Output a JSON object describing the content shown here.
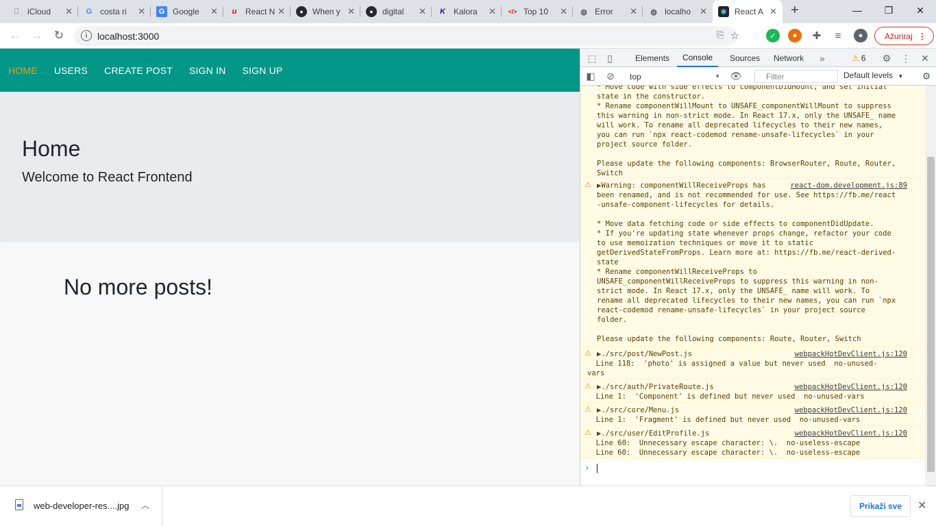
{
  "tabs": [
    {
      "title": "iCloud",
      "icon": "apple-icon"
    },
    {
      "title": "costa ri",
      "icon": "google-icon"
    },
    {
      "title": "Google",
      "icon": "google-translate-icon"
    },
    {
      "title": "React N",
      "icon": "react-native-icon"
    },
    {
      "title": "When y",
      "icon": "github-icon"
    },
    {
      "title": "digital",
      "icon": "github-icon"
    },
    {
      "title": "Kalora",
      "icon": "kaloraat-icon"
    },
    {
      "title": "Top 10",
      "icon": "code-icon"
    },
    {
      "title": "Error",
      "icon": "globe-icon"
    },
    {
      "title": "localho",
      "icon": "globe-icon"
    },
    {
      "title": "React A",
      "icon": "react-icon",
      "active": true
    }
  ],
  "toolbar": {
    "url": "localhost:3000",
    "update_label": "Ažuriraj"
  },
  "page": {
    "nav": [
      "HOME",
      "USERS",
      "CREATE POST",
      "SIGN IN",
      "SIGN UP"
    ],
    "nav_active_color": "#ff9900",
    "navbar_color": "#009688",
    "jumbo_title": "Home",
    "jumbo_subtitle": "Welcome to React Frontend",
    "empty_message": "No more posts!"
  },
  "devtools": {
    "tabs": [
      "Elements",
      "Console",
      "Sources",
      "Network"
    ],
    "warning_count": "6",
    "context": "top",
    "filter_placeholder": "Filter",
    "levels": "Default levels",
    "messages": {
      "m1": "* Move code with side effects to componentDidMount, and set initial\nstate in the constructor.\n* Rename componentWillMount to UNSAFE_componentWillMount to suppress\nthis warning in non-strict mode. In React 17.x, only the UNSAFE_ name\nwill work. To rename all deprecated lifecycles to their new names,\nyou can run `npx react-codemod rename-unsafe-lifecycles` in your\nproject source folder.\n\nPlease update the following components: BrowserRouter, Route, Router,\nSwitch",
      "m2_head": "▶Warning: componentWillReceiveProps has",
      "m2_src": "react-dom.development.js:89",
      "m2_body": "been renamed, and is not recommended for use. See https://fb.me/react\n-unsafe-component-lifecycles for details.\n\n* Move data fetching code or side effects to componentDidUpdate.\n* If you're updating state whenever props change, refactor your code\nto use memoization techniques or move it to static\ngetDerivedStateFromProps. Learn more at: https://fb.me/react-derived-\nstate\n* Rename componentWillReceiveProps to\nUNSAFE_componentWillReceiveProps to suppress this warning in non-\nstrict mode. In React 17.x, only the UNSAFE_ name will work. To\nrename all deprecated lifecycles to their new names, you can run `npx\nreact-codemod rename-unsafe-lifecycles` in your project source\nfolder.\n\nPlease update the following components: Route, Router, Switch",
      "m3_head": "▶./src/post/NewPost.js",
      "m3_src": "webpackHotDevClient.js:120",
      "m3_body": "  Line 118:  'photo' is assigned a value but never used  no-unused-\nvars",
      "m4_head": "▶./src/auth/PrivateRoute.js",
      "m4_src": "webpackHotDevClient.js:120",
      "m4_body": "  Line 1:  'Component' is defined but never used  no-unused-vars",
      "m5_head": "▶./src/core/Menu.js",
      "m5_src": "webpackHotDevClient.js:120",
      "m5_body": "  Line 1:  'Fragment' is defined but never used  no-unused-vars",
      "m6_head": "▶./src/user/EditProfile.js",
      "m6_src": "webpackHotDevClient.js:120",
      "m6_body": "  Line 60:  Unnecessary escape character: \\.  no-useless-escape\n  Line 60:  Unnecessary escape character: \\.  no-useless-escape"
    }
  },
  "downloads": {
    "file_name": "web-developer-res....jpg",
    "show_all_label": "Prikaži sve"
  }
}
